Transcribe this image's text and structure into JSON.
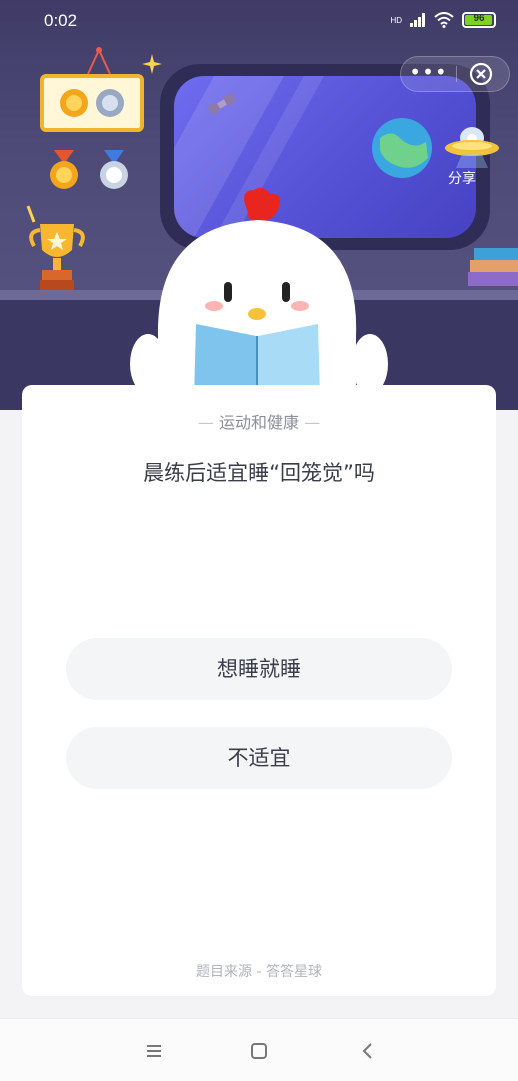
{
  "status_bar": {
    "time": "0:02",
    "network_label": "HD",
    "battery_level": "96",
    "battery_fraction": 0.96,
    "icons": [
      "signal-icon",
      "wifi-icon",
      "battery-icon"
    ]
  },
  "capsule": {
    "more_label": "•••",
    "icons": [
      "more-icon",
      "close-icon"
    ]
  },
  "header": {
    "share_label": "分享"
  },
  "question": {
    "category": "运动和健康",
    "text": "晨练后适宜睡“回笼觉”吗",
    "options": [
      {
        "label": "想睡就睡"
      },
      {
        "label": "不适宜"
      }
    ],
    "source": "题目来源 - 答答星球"
  },
  "colors": {
    "hero_bg": "#4d4a78",
    "card_bg": "#ffffff",
    "option_bg": "#f4f5f7",
    "text_primary": "#3a3d4a",
    "text_muted": "#8b8e9c"
  },
  "nav_bar": {
    "icons": [
      "menu-icon",
      "home-icon",
      "back-icon"
    ]
  }
}
